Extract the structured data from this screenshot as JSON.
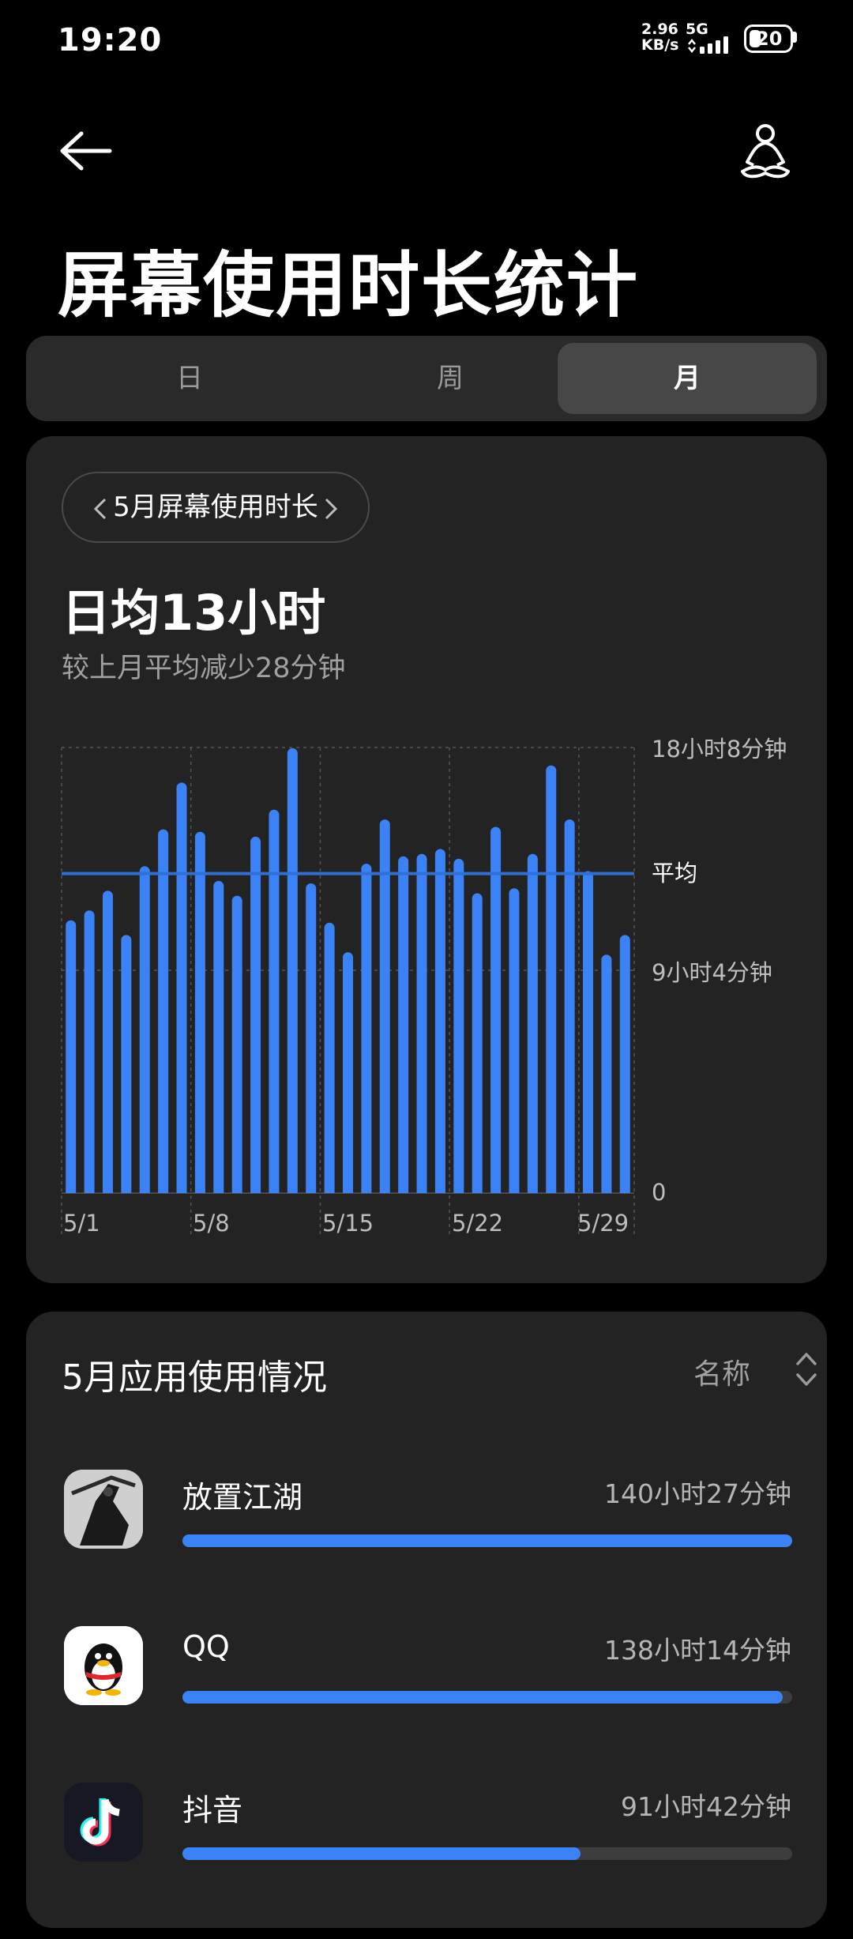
{
  "status": {
    "time": "19:20",
    "net_speed": "2.96",
    "net_unit": "KB/s",
    "net_type": "5G",
    "battery": "20"
  },
  "header": {
    "title": "屏幕使用时长统计",
    "back_icon": "arrow-left-icon",
    "mode_icon": "meditation-icon"
  },
  "tabs": [
    {
      "label": "日",
      "active": false
    },
    {
      "label": "周",
      "active": false
    },
    {
      "label": "月",
      "active": true
    }
  ],
  "summary": {
    "period_label": "5月屏幕使用时长",
    "average": "日均13小时",
    "comparison": "较上月平均减少28分钟"
  },
  "chart_data": {
    "type": "bar",
    "categories": [
      "5/1",
      "5/2",
      "5/3",
      "5/4",
      "5/5",
      "5/6",
      "5/7",
      "5/8",
      "5/9",
      "5/10",
      "5/11",
      "5/12",
      "5/13",
      "5/14",
      "5/15",
      "5/16",
      "5/17",
      "5/18",
      "5/19",
      "5/20",
      "5/21",
      "5/22",
      "5/23",
      "5/24",
      "5/25",
      "5/26",
      "5/27",
      "5/28",
      "5/29",
      "5/30",
      "5/31"
    ],
    "values": [
      11.1,
      11.5,
      12.3,
      10.5,
      13.3,
      14.8,
      16.7,
      14.7,
      12.7,
      12.1,
      14.5,
      15.6,
      18.1,
      12.6,
      11.0,
      9.8,
      13.4,
      15.2,
      13.7,
      13.8,
      14.0,
      13.6,
      12.2,
      14.9,
      12.4,
      13.8,
      17.4,
      15.2,
      13.1,
      9.7,
      10.5
    ],
    "xtick_labels": [
      "5/1",
      "5/8",
      "5/15",
      "5/22",
      "5/29"
    ],
    "ytick_labels": [
      "18小时8分钟",
      "9小时4分钟",
      "0"
    ],
    "reference_line": {
      "label": "平均",
      "value": 13
    },
    "ylim": [
      0,
      18.13
    ],
    "grid": true,
    "bar_color": "#3b82f6",
    "avg_line_color": "#2f6fd6"
  },
  "usage": {
    "title": "5月应用使用情况",
    "sort_label": "名称",
    "sort_icon": "sort-updown-icon",
    "apps": [
      {
        "name": "放置江湖",
        "time": "140小时27分钟",
        "fraction": 1.0,
        "icon": "fangzhi-jianghu-icon"
      },
      {
        "name": "QQ",
        "time": "138小时14分钟",
        "fraction": 0.984,
        "icon": "qq-penguin-icon"
      },
      {
        "name": "抖音",
        "time": "91小时42分钟",
        "fraction": 0.653,
        "icon": "douyin-note-icon"
      }
    ]
  },
  "colors": {
    "accent": "#3b82f6",
    "card": "#232323",
    "background": "#000000"
  }
}
